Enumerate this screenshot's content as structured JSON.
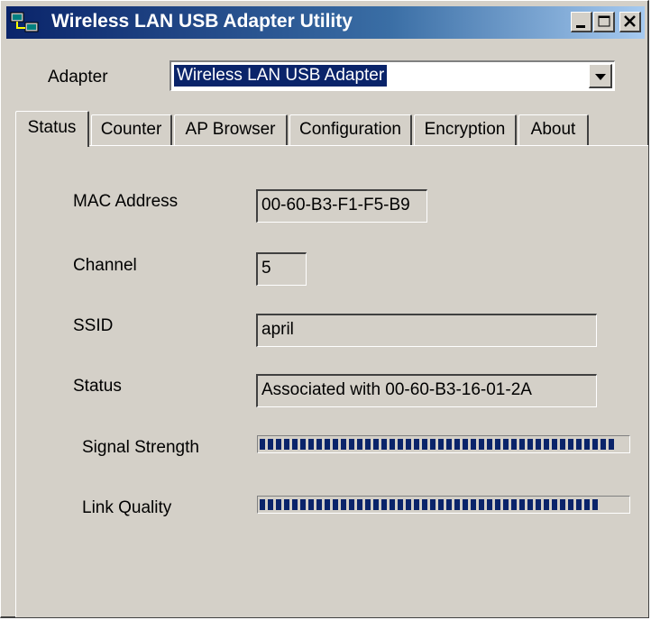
{
  "window": {
    "title": "Wireless LAN USB Adapter Utility",
    "controls": {
      "minimize_icon": "minimize-icon",
      "maximize_icon": "maximize-icon",
      "close_icon": "close-icon"
    }
  },
  "adapter": {
    "label": "Adapter",
    "selected": "Wireless LAN USB Adapter"
  },
  "tabs": [
    {
      "label": "Status",
      "active": true
    },
    {
      "label": "Counter",
      "active": false
    },
    {
      "label": "AP Browser",
      "active": false
    },
    {
      "label": "Configuration",
      "active": false
    },
    {
      "label": "Encryption",
      "active": false
    },
    {
      "label": "About",
      "active": false
    }
  ],
  "status": {
    "mac_label": "MAC Address",
    "mac_value": "00-60-B3-F1-F5-B9",
    "channel_label": "Channel",
    "channel_value": "5",
    "ssid_label": "SSID",
    "ssid_value": "april",
    "status_label": "Status",
    "status_value": "Associated with 00-60-B3-16-01-2A",
    "signal_label": "Signal Strength",
    "signal_level": 0.97,
    "link_label": "Link Quality",
    "link_level": 0.92
  },
  "colors": {
    "titlebar_start": "#0a246a",
    "titlebar_end": "#a6caf0",
    "face": "#d4d0c8",
    "highlight": "#0a246a",
    "meter_fill": "#0a246a"
  }
}
